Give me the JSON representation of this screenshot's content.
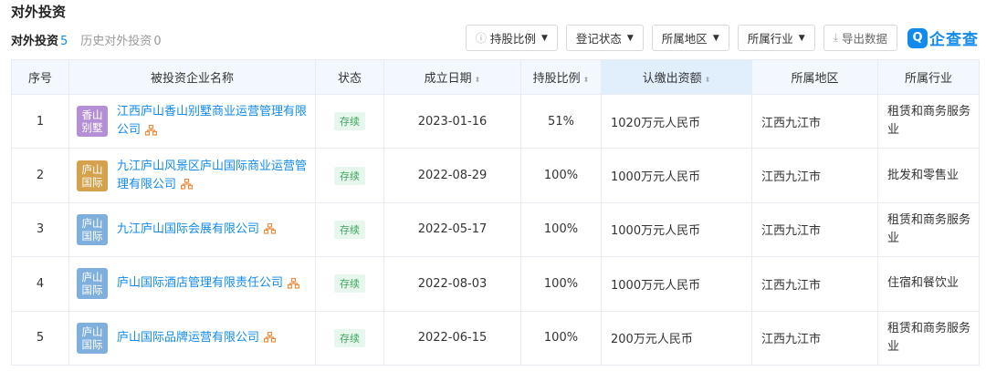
{
  "section": {
    "title": "对外投资"
  },
  "tabs": [
    {
      "label": "对外投资",
      "count": "5"
    },
    {
      "label": "历史对外投资",
      "count": "0"
    }
  ],
  "toolbar": {
    "ratio_label": "持股比例",
    "status_label": "登记状态",
    "region_label": "所属地区",
    "industry_label": "所属行业",
    "export_label": "导出数据",
    "brand_name": "企查查",
    "brand_letter": "Q"
  },
  "table": {
    "headers": {
      "index": "序号",
      "company": "被投资企业名称",
      "status": "状态",
      "date": "成立日期",
      "ratio": "持股比例",
      "capital": "认缴出资额",
      "region": "所属地区",
      "industry": "所属行业"
    },
    "rows": [
      {
        "index": "1",
        "logo": "香山别墅",
        "logo_color": "#b58fd6",
        "name": "江西庐山香山别墅商业运营管理有限公司",
        "status": "存续",
        "date": "2023-01-16",
        "ratio": "51%",
        "capital": "1020万元人民币",
        "region": "江西九江市",
        "industry": "租赁和商务服务业"
      },
      {
        "index": "2",
        "logo": "庐山国际",
        "logo_color": "#d4a24c",
        "name": "九江庐山风景区庐山国际商业运营管理有限公司",
        "status": "存续",
        "date": "2022-08-29",
        "ratio": "100%",
        "capital": "1000万元人民币",
        "region": "江西九江市",
        "industry": "批发和零售业"
      },
      {
        "index": "3",
        "logo": "庐山国际",
        "logo_color": "#7fb0dd",
        "name": "九江庐山国际会展有限公司",
        "status": "存续",
        "date": "2022-05-17",
        "ratio": "100%",
        "capital": "1000万元人民币",
        "region": "江西九江市",
        "industry": "租赁和商务服务业"
      },
      {
        "index": "4",
        "logo": "庐山国际",
        "logo_color": "#7fb0dd",
        "name": "庐山国际酒店管理有限责任公司",
        "status": "存续",
        "date": "2022-08-03",
        "ratio": "100%",
        "capital": "1000万元人民币",
        "region": "江西九江市",
        "industry": "住宿和餐饮业"
      },
      {
        "index": "5",
        "logo": "庐山国际",
        "logo_color": "#7fb0dd",
        "name": "庐山国际品牌运营有限公司",
        "status": "存续",
        "date": "2022-06-15",
        "ratio": "100%",
        "capital": "200万元人民币",
        "region": "江西九江市",
        "industry": "租赁和商务服务业"
      }
    ]
  }
}
